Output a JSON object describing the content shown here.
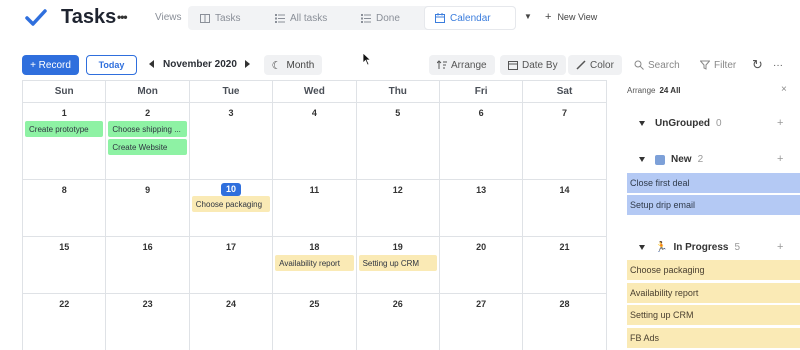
{
  "app": {
    "title": "Tasks",
    "more": "•••"
  },
  "views": {
    "label": "Views",
    "tabs": [
      {
        "label": "Tasks",
        "icon": "table-icon"
      },
      {
        "label": "All tasks",
        "icon": "list-icon"
      },
      {
        "label": "Done",
        "icon": "list-icon"
      },
      {
        "label": "Calendar",
        "icon": "calendar-icon",
        "active": true
      }
    ],
    "new_view": "New View"
  },
  "toolbar": {
    "record": "+ Record",
    "today": "Today",
    "month_label": "November 2020",
    "month_mode": "Month",
    "arrange": "Arrange",
    "date_by": "Date By",
    "color": "Color",
    "search": "Search",
    "filter": "Filter",
    "more": "···"
  },
  "calendar": {
    "days_of_week": [
      "Sun",
      "Mon",
      "Tue",
      "Wed",
      "Thu",
      "Fri",
      "Sat"
    ],
    "weeks": [
      [
        {
          "num": "1",
          "events": [
            {
              "title": "Create prototype",
              "color": "green"
            }
          ]
        },
        {
          "num": "2",
          "events": [
            {
              "title": "Choose shipping ...",
              "color": "green"
            },
            {
              "title": "Create Website",
              "color": "green"
            }
          ]
        },
        {
          "num": "3",
          "events": []
        },
        {
          "num": "4",
          "events": []
        },
        {
          "num": "5",
          "events": []
        },
        {
          "num": "6",
          "events": []
        },
        {
          "num": "7",
          "events": []
        }
      ],
      [
        {
          "num": "8",
          "events": []
        },
        {
          "num": "9",
          "events": []
        },
        {
          "num": "10",
          "today": true,
          "events": [
            {
              "title": "Choose packaging",
              "color": "yellow"
            }
          ]
        },
        {
          "num": "11",
          "events": []
        },
        {
          "num": "12",
          "events": []
        },
        {
          "num": "13",
          "events": []
        },
        {
          "num": "14",
          "events": []
        }
      ],
      [
        {
          "num": "15",
          "events": []
        },
        {
          "num": "16",
          "events": []
        },
        {
          "num": "17",
          "events": []
        },
        {
          "num": "18",
          "events": [
            {
              "title": "Availability report",
              "color": "yellow"
            }
          ]
        },
        {
          "num": "19",
          "events": [
            {
              "title": "Setting up CRM",
              "color": "yellow"
            }
          ]
        },
        {
          "num": "20",
          "events": []
        },
        {
          "num": "21",
          "events": []
        }
      ],
      [
        {
          "num": "22",
          "events": []
        },
        {
          "num": "23",
          "events": []
        },
        {
          "num": "24",
          "events": []
        },
        {
          "num": "25",
          "events": []
        },
        {
          "num": "26",
          "events": []
        },
        {
          "num": "27",
          "events": []
        },
        {
          "num": "28",
          "events": []
        }
      ]
    ]
  },
  "side_panel": {
    "title": "Arrange",
    "count": "24 All",
    "close": "×",
    "groups": [
      {
        "name": "UnGrouped",
        "count": "0",
        "items": []
      },
      {
        "name": "New",
        "count": "2",
        "icon": "new-badge-icon",
        "items": [
          {
            "label": "Close first deal",
            "color": "blue"
          },
          {
            "label": "Setup drip email",
            "color": "blue"
          }
        ]
      },
      {
        "name": "In Progress",
        "count": "5",
        "icon": "runner-icon",
        "items": [
          {
            "label": "Choose packaging",
            "color": "yellow"
          },
          {
            "label": "Availability report",
            "color": "yellow"
          },
          {
            "label": "Setting up CRM",
            "color": "yellow"
          },
          {
            "label": "FB Ads",
            "color": "yellow"
          }
        ]
      }
    ]
  },
  "colors": {
    "accent": "#2f6fdd",
    "event_green": "#8ef2a4",
    "event_yellow": "#faeab5",
    "group_blue": "#b4c9f4"
  }
}
